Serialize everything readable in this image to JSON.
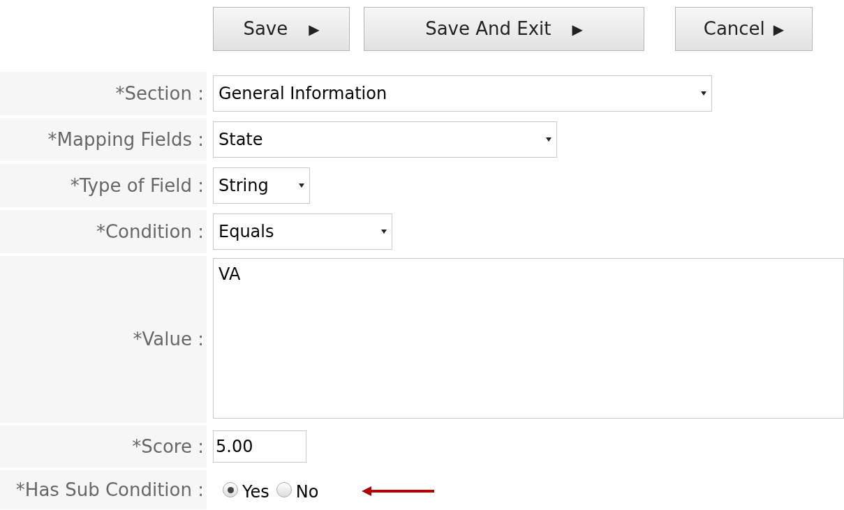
{
  "buttons": [
    {
      "label": "Save",
      "icon": "▶"
    },
    {
      "label": "Save And Exit",
      "icon": "▶"
    },
    {
      "label": "Cancel",
      "icon": "▶"
    }
  ],
  "fields": [
    {
      "kind": "select",
      "label": "*Section :",
      "value": "General Information"
    },
    {
      "kind": "select",
      "label": "*Mapping Fields :",
      "value": "State"
    },
    {
      "kind": "select",
      "label": "*Type of Field :",
      "value": "String"
    },
    {
      "kind": "select",
      "label": "*Condition :",
      "value": "Equals"
    },
    {
      "kind": "textarea",
      "label": "*Value :",
      "value": "VA"
    },
    {
      "kind": "text",
      "label": "*Score :",
      "value": "5.00"
    },
    {
      "kind": "radio",
      "label": "*Has Sub Condition :",
      "options": [
        {
          "label": "Yes",
          "selected": true
        },
        {
          "label": "No",
          "selected": false
        }
      ]
    }
  ]
}
